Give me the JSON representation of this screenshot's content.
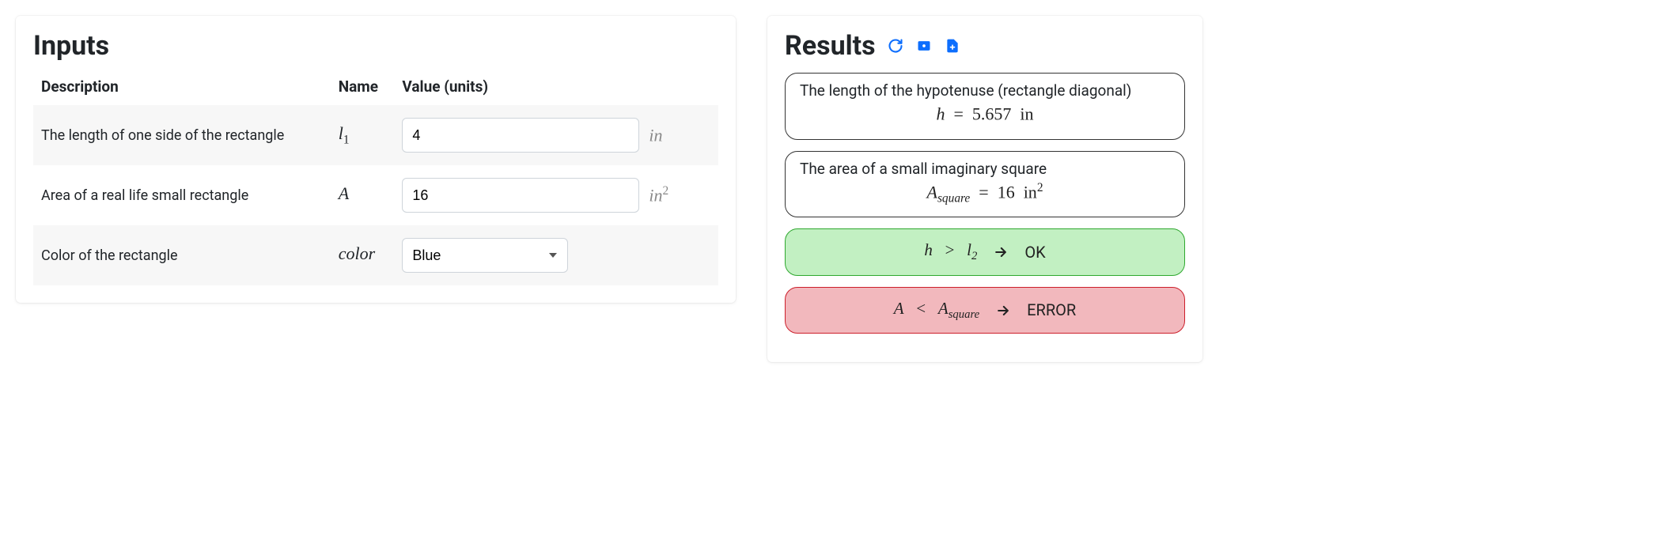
{
  "inputs": {
    "title": "Inputs",
    "headers": {
      "description": "Description",
      "name": "Name",
      "value": "Value (units)"
    },
    "rows": [
      {
        "description": "The length of one side of the rectangle",
        "name_base": "l",
        "name_sub": "1",
        "value": "4",
        "unit_base": "in",
        "unit_sup": ""
      },
      {
        "description": "Area of a real life small rectangle",
        "name_base": "A",
        "name_sub": "",
        "value": "16",
        "unit_base": "in",
        "unit_sup": "2"
      },
      {
        "description": "Color of the rectangle",
        "name_base": "color",
        "name_sub": "",
        "select_value": "Blue"
      }
    ]
  },
  "results": {
    "title": "Results",
    "items": [
      {
        "description": "The length of the hypotenuse (rectangle diagonal)",
        "lhs_base": "h",
        "lhs_sub": "",
        "rhs_value": "5.657",
        "rhs_unit": "in",
        "rhs_unit_sup": ""
      },
      {
        "description": "The area of a small imaginary square",
        "lhs_base": "A",
        "lhs_sub": "square",
        "rhs_value": "16",
        "rhs_unit": "in",
        "rhs_unit_sup": "2"
      }
    ],
    "checks": [
      {
        "status": "ok",
        "l_base": "h",
        "l_sub": "",
        "op": ">",
        "r_base": "l",
        "r_sub": "2",
        "label": "OK"
      },
      {
        "status": "error",
        "l_base": "A",
        "l_sub": "",
        "op": "<",
        "r_base": "A",
        "r_sub": "square",
        "label": "ERROR"
      }
    ]
  }
}
